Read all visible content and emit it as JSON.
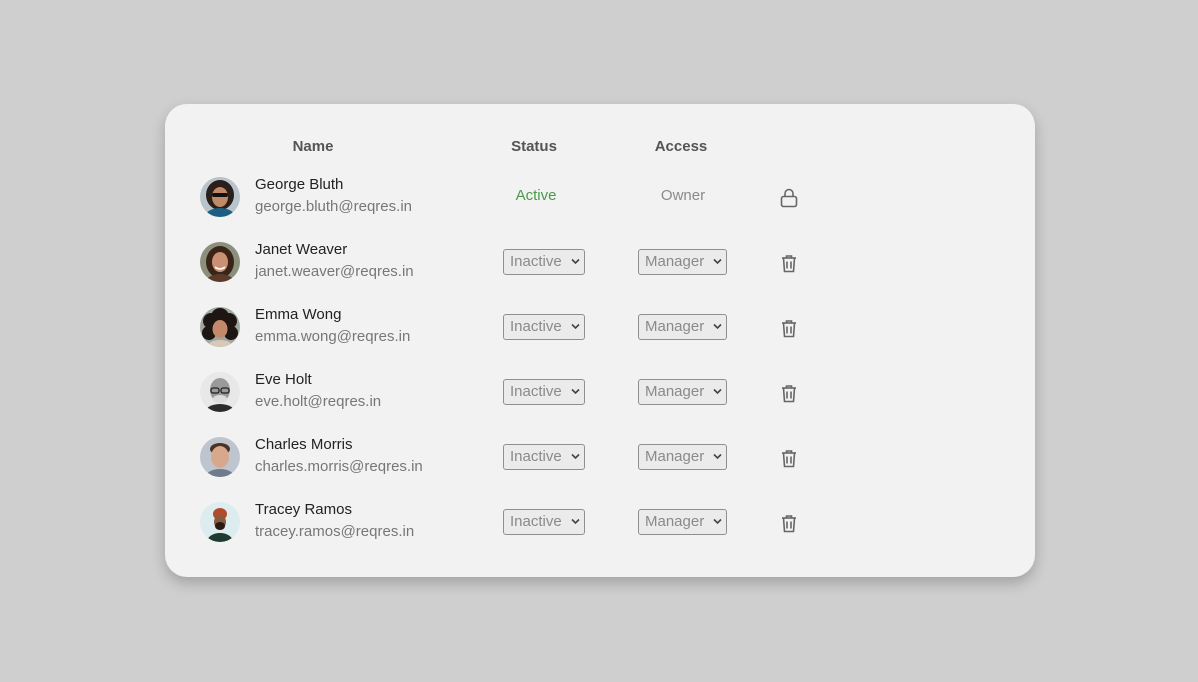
{
  "headers": {
    "name": "Name",
    "status": "Status",
    "access": "Access"
  },
  "colors": {
    "active": "#4a9a4a",
    "muted": "#8a8a8a",
    "card": "#f2f2f2",
    "background": "#cfcfcf"
  },
  "users": [
    {
      "name": "George Bluth",
      "email": "george.bluth@reqres.in",
      "status": "Active",
      "access": "Owner",
      "editable": false,
      "action_icon": "lock-icon"
    },
    {
      "name": "Janet Weaver",
      "email": "janet.weaver@reqres.in",
      "status": "Inactive",
      "access": "Manager",
      "editable": true,
      "action_icon": "trash-icon"
    },
    {
      "name": "Emma Wong",
      "email": "emma.wong@reqres.in",
      "status": "Inactive",
      "access": "Manager",
      "editable": true,
      "action_icon": "trash-icon"
    },
    {
      "name": "Eve Holt",
      "email": "eve.holt@reqres.in",
      "status": "Inactive",
      "access": "Manager",
      "editable": true,
      "action_icon": "trash-icon"
    },
    {
      "name": "Charles Morris",
      "email": "charles.morris@reqres.in",
      "status": "Inactive",
      "access": "Manager",
      "editable": true,
      "action_icon": "trash-icon"
    },
    {
      "name": "Tracey Ramos",
      "email": "tracey.ramos@reqres.in",
      "status": "Inactive",
      "access": "Manager",
      "editable": true,
      "action_icon": "trash-icon"
    }
  ]
}
